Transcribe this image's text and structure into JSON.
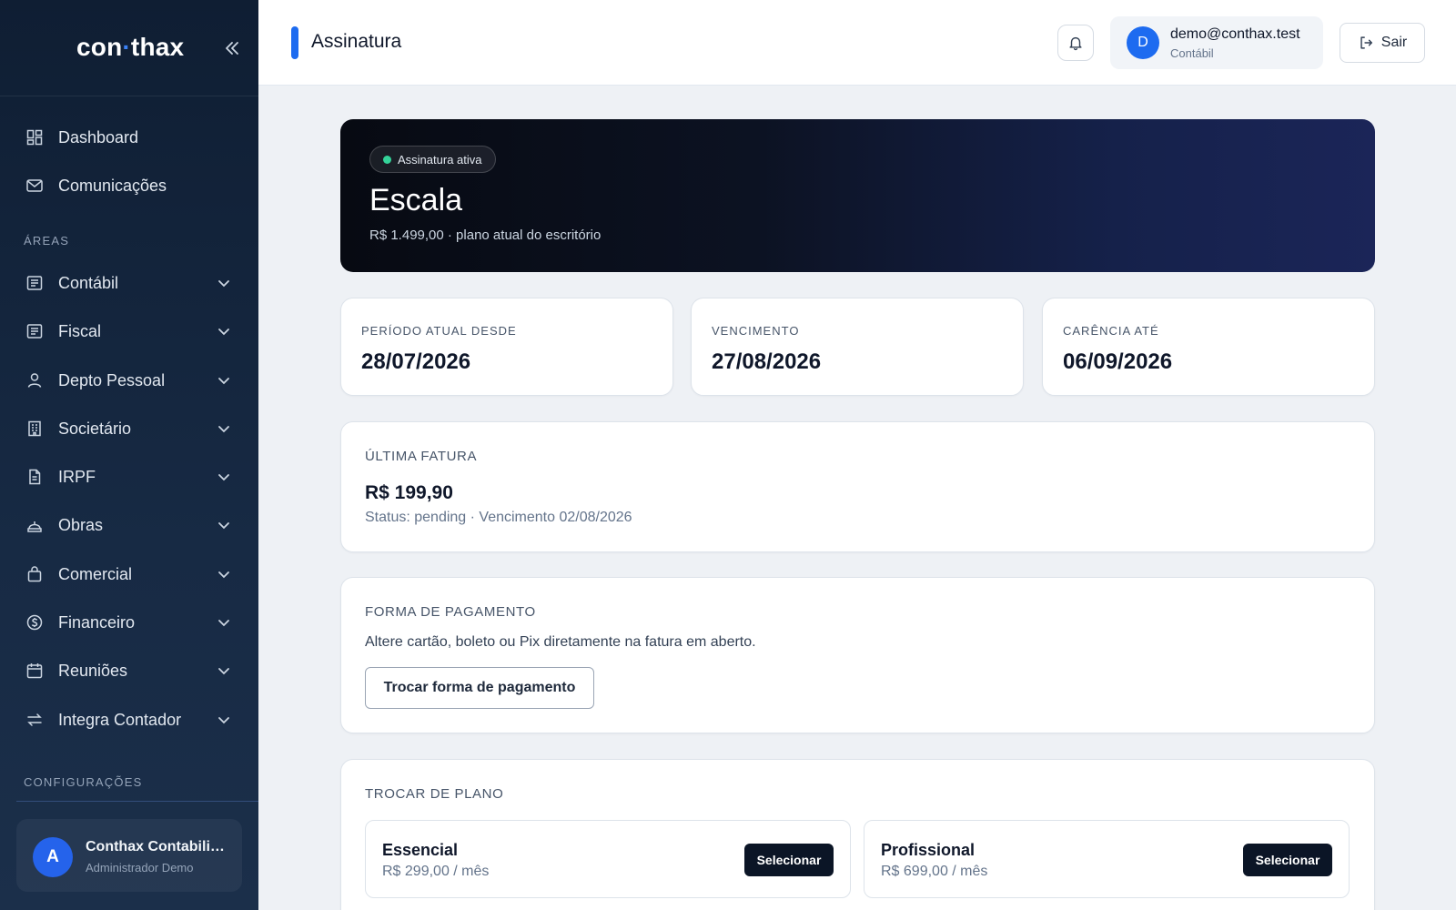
{
  "sidebar": {
    "logo_left": "con",
    "logo_dot": "·",
    "logo_right": "thax",
    "items_top": [
      {
        "label": "Dashboard",
        "icon": "dashboard-icon"
      },
      {
        "label": "Comunicações",
        "icon": "mail-icon"
      }
    ],
    "section_areas": "ÁREAS",
    "areas": [
      {
        "label": "Contábil",
        "icon": "ledger-icon"
      },
      {
        "label": "Fiscal",
        "icon": "ledger-icon"
      },
      {
        "label": "Depto Pessoal",
        "icon": "user-icon"
      },
      {
        "label": "Societário",
        "icon": "building-icon"
      },
      {
        "label": "IRPF",
        "icon": "document-icon"
      },
      {
        "label": "Obras",
        "icon": "construction-icon"
      },
      {
        "label": "Comercial",
        "icon": "bag-icon"
      },
      {
        "label": "Financeiro",
        "icon": "currency-icon"
      },
      {
        "label": "Reuniões",
        "icon": "calendar-icon"
      },
      {
        "label": "Integra Contador",
        "icon": "swap-icon"
      }
    ],
    "section_config": "CONFIGURAÇÕES",
    "user": {
      "initial": "A",
      "name": "Conthax Contabilidade",
      "role": "Administrador Demo"
    }
  },
  "topbar": {
    "title": "Assinatura",
    "account": {
      "initial": "D",
      "email": "demo@conthax.test",
      "role": "Contábil"
    },
    "logout_label": "Sair"
  },
  "hero": {
    "badge": "Assinatura ativa",
    "plan": "Escala",
    "subtitle": "R$ 1.499,00 · plano atual do escritório"
  },
  "stats": [
    {
      "label": "PERÍODO ATUAL DESDE",
      "value": "28/07/2026"
    },
    {
      "label": "VENCIMENTO",
      "value": "27/08/2026"
    },
    {
      "label": "CARÊNCIA ATÉ",
      "value": "06/09/2026"
    }
  ],
  "invoice": {
    "label": "ÚLTIMA FATURA",
    "value": "R$ 199,90",
    "status": "Status: pending · Vencimento 02/08/2026"
  },
  "payment": {
    "label": "FORMA DE PAGAMENTO",
    "description": "Altere cartão, boleto ou Pix diretamente na fatura em aberto.",
    "button": "Trocar forma de pagamento"
  },
  "change_plan": {
    "label": "TROCAR DE PLANO",
    "plans": [
      {
        "name": "Essencial",
        "price": "R$ 299,00 / mês",
        "button": "Selecionar"
      },
      {
        "name": "Profissional",
        "price": "R$ 699,00 / mês",
        "button": "Selecionar"
      }
    ]
  },
  "colors": {
    "accent": "#1d6bf0",
    "active_dot": "#34d399",
    "sidebar_bg": "#0f1e33"
  }
}
